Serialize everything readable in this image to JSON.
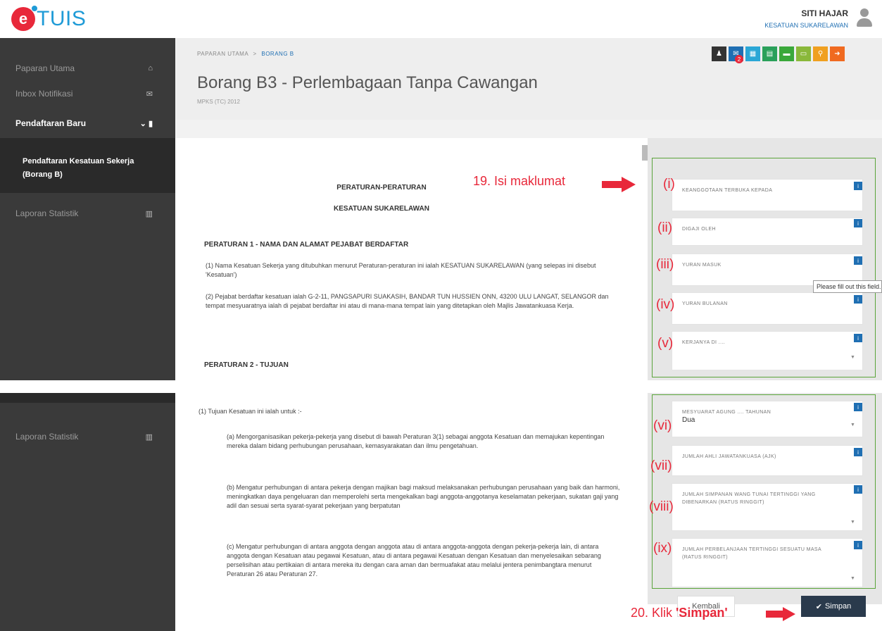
{
  "app": {
    "logo_text": "TUIS",
    "logo_letter": "e"
  },
  "user": {
    "name": "SITI HAJAR",
    "org": "KESATUAN SUKARELAWAN"
  },
  "sidebar": {
    "items": [
      {
        "label": "Paparan Utama",
        "icon": "home-icon"
      },
      {
        "label": "Inbox Notifikasi",
        "icon": "envelope-icon"
      },
      {
        "label": "Pendaftaran Baru",
        "icon": "file-icon"
      },
      {
        "label": "Laporan Statistik",
        "icon": "bar-chart-icon"
      }
    ],
    "sub_item": "Pendaftaran Kesatuan Sekerja (Borang B)",
    "bottom_item": "Laporan Statistik"
  },
  "breadcrumb": {
    "home": "PAPARAN UTAMA",
    "sep": ">",
    "current": "BORANG B"
  },
  "page": {
    "title": "Borang B3 - Perlembagaan Tanpa Cawangan",
    "subtitle": "MPKS (TC) 2012"
  },
  "toolbar": {
    "badge": "2",
    "buttons": [
      {
        "icon": "user-icon",
        "color": "#333333",
        "glyph": "♟"
      },
      {
        "icon": "mail-icon",
        "color": "#1f6fb3",
        "glyph": "✉"
      },
      {
        "icon": "calendar-icon",
        "color": "#2aa7d6",
        "glyph": "▦"
      },
      {
        "icon": "document-icon",
        "color": "#2aa05a",
        "glyph": "▤"
      },
      {
        "icon": "folder-icon",
        "color": "#3aa83a",
        "glyph": "▬"
      },
      {
        "icon": "card-icon",
        "color": "#8ab83a",
        "glyph": "▭"
      },
      {
        "icon": "search-icon",
        "color": "#f0a020",
        "glyph": "⚲"
      },
      {
        "icon": "logout-icon",
        "color": "#f06a20",
        "glyph": "➜"
      }
    ]
  },
  "document": {
    "heading1": "PERATURAN-PERATURAN",
    "heading2": "KESATUAN SUKARELAWAN",
    "rule1_title": "PERATURAN 1  -  NAMA DAN ALAMAT PEJABAT BERDAFTAR",
    "rule1_p1": "(1)  Nama Kesatuan Sekerja yang ditubuhkan menurut Peraturan-peraturan ini ialah KESATUAN SUKARELAWAN (yang selepas ini disebut 'Kesatuan')",
    "rule1_p2": "(2)  Pejabat berdaftar kesatuan ialah G-2-11, PANGSAPURI SUAKASIH, BANDAR TUN HUSSIEN ONN, 43200 ULU LANGAT, SELANGOR dan tempat mesyuaratnya ialah di pejabat berdaftar ini atau di mana-mana tempat lain yang ditetapkan oleh Majlis Jawatankuasa Kerja.",
    "rule2_title": "PERATURAN 2    -    TUJUAN",
    "rule2_intro": "(1)  Tujuan Kesatuan ini ialah untuk :-",
    "rule2_a": "(a)  Mengorganisasikan pekerja-pekerja yang disebut di bawah Peraturan 3(1) sebagai anggota Kesatuan dan memajukan kepentingan mereka dalam bidang perhubungan perusahaan, kemasyarakatan dan ilmu pengetahuan.",
    "rule2_b": "(b)  Mengatur perhubungan di antara pekerja dengan majikan bagi maksud melaksanakan perhubungan perusahaan yang baik dan harmoni, meningkatkan daya pengeluaran dan memperolehi serta mengekalkan bagi anggota-anggotanya keselamatan pekerjaan, sukatan gaji yang adil dan sesuai serta syarat-syarat pekerjaan yang berpatutan",
    "rule2_c": "(c)  Mengatur perhubungan di antara anggota dengan anggota atau di antara anggota-anggota dengan pekerja-pekerja lain, di antara anggota dengan Kesatuan atau pegawai Kesatuan, atau di antara pegawai Kesatuan dengan Kesatuan dan menyelesaikan sebarang perselisihan atau pertikaian di antara mereka itu dengan cara aman dan bermuafakat atau melalui jentera penimbangtara menurut Peraturan 26 atau Peraturan 27."
  },
  "fields": [
    {
      "roman": "(i)",
      "label": "KEANGGOTAAN TERBUKA KEPADA",
      "value": ""
    },
    {
      "roman": "(ii)",
      "label": "DIGAJI OLEH",
      "value": ""
    },
    {
      "roman": "(iii)",
      "label": "YURAN MASUK",
      "value": ""
    },
    {
      "roman": "(iv)",
      "label": "YURAN BULANAN",
      "value": ""
    },
    {
      "roman": "(v)",
      "label": "KERJANYA DI ....",
      "value": ""
    },
    {
      "roman": "(vi)",
      "label": "MESYUARAT AGUNG .... TAHUNAN",
      "value": "Dua"
    },
    {
      "roman": "(vii)",
      "label": "JUMLAH AHLI JAWATANKUASA (AJK)",
      "value": ""
    },
    {
      "roman": "(viii)",
      "label": "JUMLAH SIMPANAN WANG TUNAI TERTINGGI YANG DIBENARKAN (RATUS RINGGIT)",
      "value": ""
    },
    {
      "roman": "(ix)",
      "label": "JUMLAH PERBELANJAAN TERTINGGI SESUATU MASA (RATUS RINGGIT)",
      "value": ""
    }
  ],
  "tooltip": "Please fill out this field.",
  "annotations": {
    "step19": "19. Isi maklumat",
    "step20_prefix": "20. Klik ",
    "step20_bold": "'Simpan'"
  },
  "buttons": {
    "back": "Kembali",
    "save": "Simpan"
  },
  "colors": {
    "accent_red": "#e8283a",
    "brand_blue": "#1f9bd7",
    "green_border": "#5aa43a",
    "save_btn": "#2a3a4c"
  }
}
